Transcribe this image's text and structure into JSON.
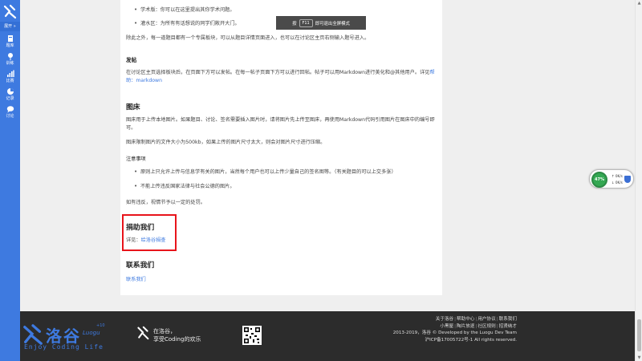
{
  "sidebar": {
    "expand_label": "展开 »",
    "items": [
      {
        "label": "题库",
        "icon": "book-icon"
      },
      {
        "label": "训练",
        "icon": "flag-icon"
      },
      {
        "label": "比赛",
        "icon": "chart-icon"
      },
      {
        "label": "记录",
        "icon": "pie-icon"
      },
      {
        "label": "讨论",
        "icon": "chat-icon"
      }
    ]
  },
  "toast": {
    "prefix": "按",
    "key": "F11",
    "suffix": "即可退出全屏模式"
  },
  "article": {
    "list1": [
      "学术版：你可以在这里提出其你学术问题。",
      "灌水区：为所有有话想说的同学们敞开大门。"
    ],
    "p1": "除此之外，每一道题目都有一个专属板块，可以从题目详情页面进入，也可以在讨论区主页右侧输入题号进入。",
    "posting_heading": "发帖",
    "p2": "在讨论区主页选择板块后，在页面下方可以发帖。在每一帖子页面下方可以进行回帖。帖子可以用Markdown进行美化和@其他用户。",
    "p3_prefix": "详见",
    "p3_link": "帮助：markdown",
    "imagebed_heading": "图床",
    "p4": "图床用于上传本地图片。如果题目、讨论、签名需要插入图片时，请将图片先上传至图床，再使用Markdown代码引用图片在图床中的编号即可。",
    "p5": "图床限制图片的文件大小为500kb，如果上传的图片尺寸太大，则会对图片尺寸进行压缩。",
    "notes_heading": "注意事项",
    "list2": [
      "原则上只允许上传与信息学有关的图片，当然每个用户也可以上传少量自己的签名图等。（有关题目的可以上交多张）",
      "不能上传违反国家法律与社会公德的图片。"
    ],
    "p6": "如有违反，视情节予以一定的处罚。",
    "donate_heading": "捐助我们",
    "donate_prefix": "详见：",
    "donate_link": "给洛谷捐查",
    "contact_heading": "联系我们",
    "contact_link": "联系我们"
  },
  "widget": {
    "percent": "47%",
    "up": "0K/s",
    "down": "0K/s"
  },
  "footer": {
    "brand_name": "洛谷",
    "brand_sub": "Luogu",
    "brand_plus": "+10",
    "brand_tagline": "Enjoy Coding Life",
    "slogan_line1": "在洛谷，",
    "slogan_line2": "享受Coding的欢乐",
    "links_row1": [
      "关于洛谷",
      "帮助中心",
      "用户协议",
      "联系我们"
    ],
    "links_row2": [
      "小黑屋",
      "陶片放逐",
      "社区规则",
      "招贤纳才"
    ],
    "copyright": "2013-2019，洛谷 © Developed by the Luogu Dev Team",
    "icp": "沪ICP备17005722号-1 All rights reserved."
  },
  "colors": {
    "brand": "#3e7ae0",
    "highlight": "#e8141b",
    "footer_bg": "#2c2c2c"
  }
}
